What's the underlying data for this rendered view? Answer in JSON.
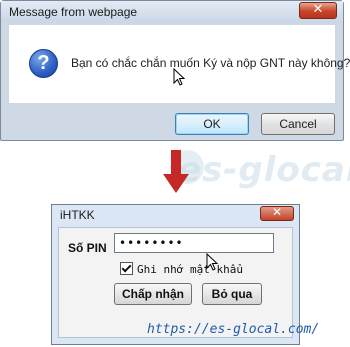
{
  "message_dialog": {
    "title": "Message from webpage",
    "close_icon": "close-icon",
    "question_icon": "?",
    "message": "Bạn có chắc chắn muốn Ký và nộp GNT này không?",
    "ok_label": "OK",
    "cancel_label": "Cancel"
  },
  "arrow": {
    "icon": "arrow-down-icon",
    "color": "#c62828"
  },
  "pin_dialog": {
    "title": "iHTKK",
    "pin_label": "Số PIN",
    "pin_value": "••••••••",
    "remember_label": "Ghi nhớ mật khẩu",
    "remember_checked": true,
    "confirm_label": "Chấp nhận",
    "skip_label": "Bỏ qua"
  },
  "watermark": {
    "text": "es-glocal"
  },
  "footer_url": "https://es-glocal.com/",
  "colors": {
    "close_button": "#c7442a",
    "ok_focus_border": "#3c7fb1",
    "url_text": "#1f5cab",
    "dialog_bg": "#cfd9e6"
  }
}
